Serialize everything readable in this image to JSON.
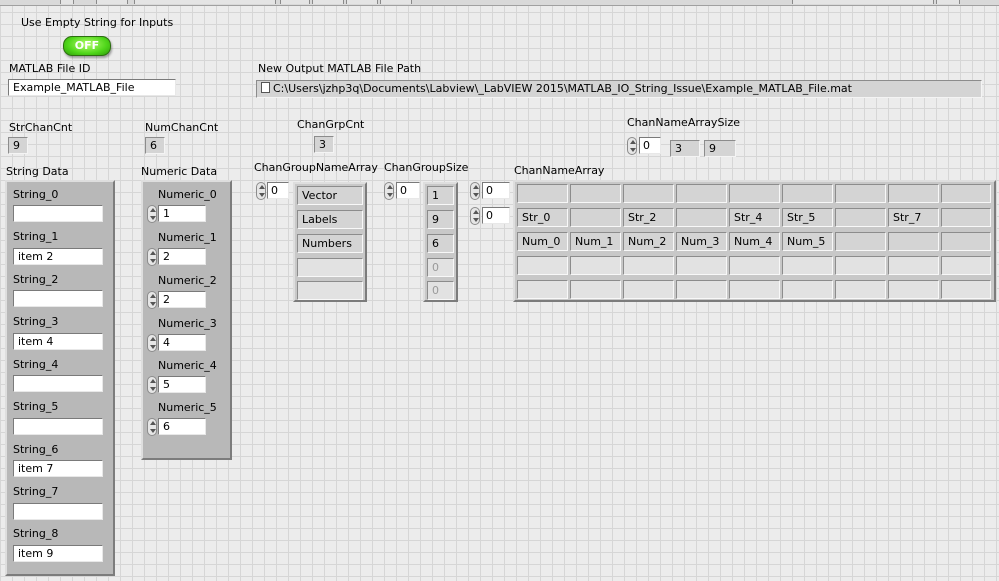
{
  "toggle_control": {
    "label": "Use Empty String for Inputs",
    "state": "OFF"
  },
  "matlab_file_id": {
    "label": "MATLAB File ID",
    "value": "Example_MATLAB_File"
  },
  "output_path": {
    "label": "New Output MATLAB File Path",
    "value": "C:\\Users\\jzhp3q\\Documents\\Labview\\_LabVIEW 2015\\MATLAB_IO_String_Issue\\Example_MATLAB_File.mat"
  },
  "str_chan_cnt": {
    "label": "StrChanCnt",
    "value": "9"
  },
  "num_chan_cnt": {
    "label": "NumChanCnt",
    "value": "6"
  },
  "chan_grp_cnt": {
    "label": "ChanGrpCnt",
    "value": "3"
  },
  "chan_name_array_size": {
    "label": "ChanNameArraySize",
    "index": "0",
    "values": [
      "3",
      "9"
    ]
  },
  "string_data": {
    "label": "String Data",
    "items": [
      {
        "label": "String_0",
        "value": ""
      },
      {
        "label": "String_1",
        "value": "item 2"
      },
      {
        "label": "String_2",
        "value": ""
      },
      {
        "label": "String_3",
        "value": "item 4"
      },
      {
        "label": "String_4",
        "value": ""
      },
      {
        "label": "String_5",
        "value": ""
      },
      {
        "label": "String_6",
        "value": "item 7"
      },
      {
        "label": "String_7",
        "value": ""
      },
      {
        "label": "String_8",
        "value": "item 9"
      }
    ]
  },
  "numeric_data": {
    "label": "Numeric Data",
    "items": [
      {
        "label": "Numeric_0",
        "value": "1"
      },
      {
        "label": "Numeric_1",
        "value": "2"
      },
      {
        "label": "Numeric_2",
        "value": "2"
      },
      {
        "label": "Numeric_3",
        "value": "4"
      },
      {
        "label": "Numeric_4",
        "value": "5"
      },
      {
        "label": "Numeric_5",
        "value": "6"
      }
    ]
  },
  "chan_group_name_array": {
    "label": "ChanGroupNameArray",
    "index": "0",
    "values": [
      "Vector",
      "Labels",
      "Numbers",
      "",
      ""
    ]
  },
  "chan_group_size": {
    "label": "ChanGroupSize",
    "index": "0",
    "values": [
      "1",
      "9",
      "6",
      "0",
      "0"
    ]
  },
  "chan_name_array": {
    "label": "ChanNameArray",
    "row_index": "0",
    "col_index": "0",
    "rows": [
      [
        "",
        "",
        "",
        "",
        "",
        "",
        "",
        "",
        ""
      ],
      [
        "Str_0",
        "",
        "Str_2",
        "",
        "Str_4",
        "Str_5",
        "",
        "Str_7",
        ""
      ],
      [
        "Num_0",
        "Num_1",
        "Num_2",
        "Num_3",
        "Num_4",
        "Num_5",
        "",
        "",
        ""
      ],
      [
        "",
        "",
        "",
        "",
        "",
        "",
        "",
        "",
        ""
      ],
      [
        "",
        "",
        "",
        "",
        "",
        "",
        "",
        "",
        ""
      ]
    ]
  }
}
